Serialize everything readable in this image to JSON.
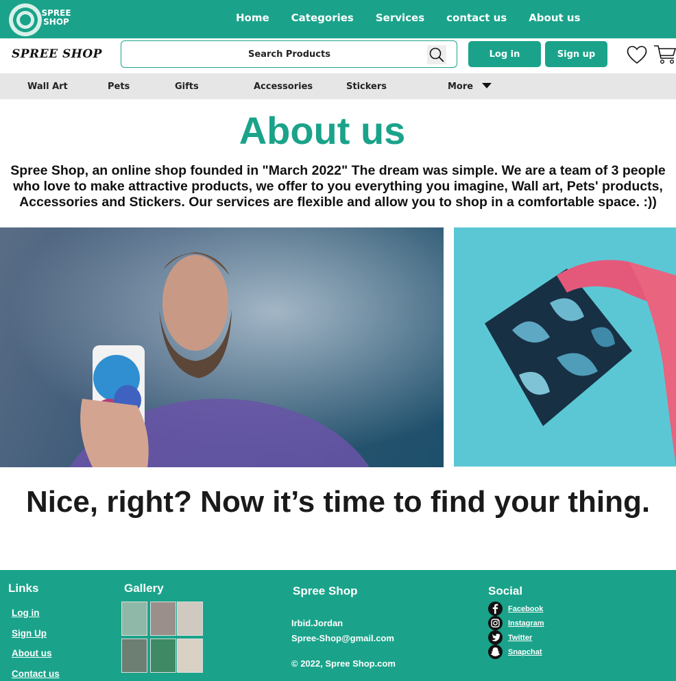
{
  "logo": {
    "text_line1": "SPREE",
    "text_line2": "SHOP"
  },
  "nav": {
    "items": [
      "Home",
      "Categories",
      "Services",
      "contact us",
      "About us"
    ]
  },
  "header": {
    "brand": "SPREE SHOP",
    "search_placeholder": "Search Products",
    "login_label": "Log in",
    "signup_label": "Sign up"
  },
  "categories": {
    "items": [
      "Wall Art",
      "Pets",
      "Gifts",
      "Accessories",
      "Stickers",
      "More"
    ]
  },
  "about": {
    "title": "About us",
    "text": "Spree Shop, an online shop founded in \"March 2022\" The dream was simple. We are a team of 3 people who love to make attractive products, we offer to you everything you imagine, Wall art, Pets' products, Accessories and Stickers. Our services are flexible and allow you to shop in a comfortable space. :))"
  },
  "tagline": "Nice, right? Now it’s time to find your thing.",
  "footer": {
    "links_heading": "Links",
    "links": [
      "Log in",
      "Sign Up",
      "About us",
      "Contact us"
    ],
    "gallery_heading": "Gallery",
    "shop_heading": "Spree Shop",
    "location": "Irbid.Jordan",
    "email": "Spree-Shop@gmail.com",
    "copyright": "© 2022, Spree Shop.com",
    "social_heading": "Social",
    "social": [
      "Facebook",
      "Instagram",
      "Twitter",
      "Snapchat"
    ]
  },
  "colors": {
    "brand": "#1aa38a",
    "category_bar": "#e6e6e6",
    "text": "#111111"
  }
}
